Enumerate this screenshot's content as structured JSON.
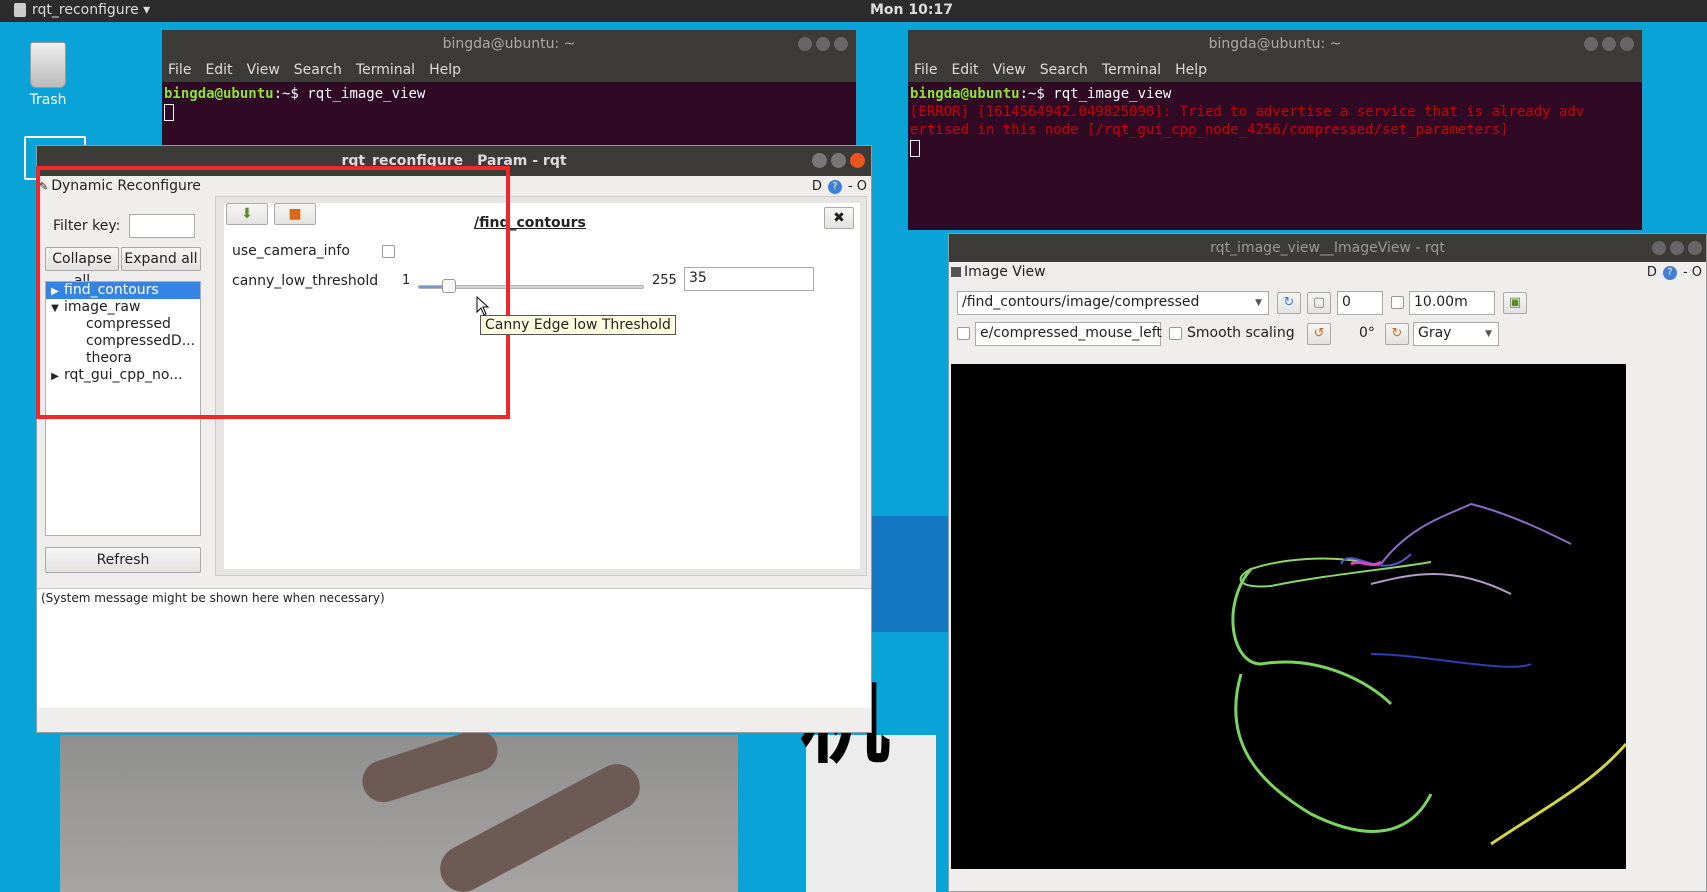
{
  "topbar": {
    "app_name": "rqt_reconfigure ▾",
    "clock": "Mon 10:17"
  },
  "desktop": {
    "trash_label": "Trash",
    "overlay_chars": "机"
  },
  "terminal_left": {
    "title": "bingda@ubuntu: ~",
    "menu": [
      "File",
      "Edit",
      "View",
      "Search",
      "Terminal",
      "Help"
    ],
    "prompt": "bingda@ubuntu",
    "prompt_suffix": ":~$ ",
    "command": "rqt_image_view"
  },
  "terminal_right": {
    "title": "bingda@ubuntu: ~",
    "menu": [
      "File",
      "Edit",
      "View",
      "Search",
      "Terminal",
      "Help"
    ],
    "prompt": "bingda@ubuntu",
    "prompt_suffix": ":~$ ",
    "command": "rqt_image_view",
    "error_line1": "[ERROR] [1614564942.049825090]: Tried to advertise a service that is already adv",
    "error_line2": "ertised in this node [/rqt_gui_cpp_node_4256/compressed/set_parameters]"
  },
  "reconfigure": {
    "window_title": "rqt_reconfigure__Param - rqt",
    "plugin_title": "Dynamic Reconfigure",
    "dock_label": "D",
    "dock_extra": "- O",
    "filter_label": "Filter key:",
    "filter_value": "",
    "collapse_label": "Collapse all",
    "expand_label": "Expand all",
    "refresh_label": "Refresh",
    "tree": [
      {
        "label": "find_contours",
        "indent": 0,
        "arrow": "▶",
        "selected": true
      },
      {
        "label": "image_raw",
        "indent": 0,
        "arrow": "▼",
        "selected": false
      },
      {
        "label": "compressed",
        "indent": 1,
        "arrow": "",
        "selected": false
      },
      {
        "label": "compressedD...",
        "indent": 1,
        "arrow": "",
        "selected": false
      },
      {
        "label": "theora",
        "indent": 1,
        "arrow": "",
        "selected": false
      },
      {
        "label": "rqt_gui_cpp_no...",
        "indent": 0,
        "arrow": "▶",
        "selected": false
      }
    ],
    "node_title": "/find_contours",
    "params": {
      "use_camera_info_label": "use_camera_info",
      "use_camera_info_checked": false,
      "canny_label": "canny_low_threshold",
      "canny_min": "1",
      "canny_max": "255",
      "canny_value": "35",
      "canny_fraction": 0.134
    },
    "tooltip": "Canny Edge low Threshold",
    "system_message": "(System message might be shown here when necessary)"
  },
  "image_view": {
    "window_title": "rqt_image_view__ImageView - rqt",
    "plugin_title": "Image View",
    "dock_label": "D",
    "dock_extra": "- O",
    "topic": "/find_contours/image/compressed",
    "spin_value": "0",
    "max_range": "10.00m",
    "mouse_topic": "e/compressed_mouse_left",
    "smooth_label": "Smooth scaling",
    "rotation": "0°",
    "color_scheme": "Gray"
  },
  "colors": {
    "accent_red": "#f0262a",
    "select_blue": "#3584e4",
    "terminal_bg": "#300a24",
    "desktop_bg": "#0aa3d8"
  }
}
